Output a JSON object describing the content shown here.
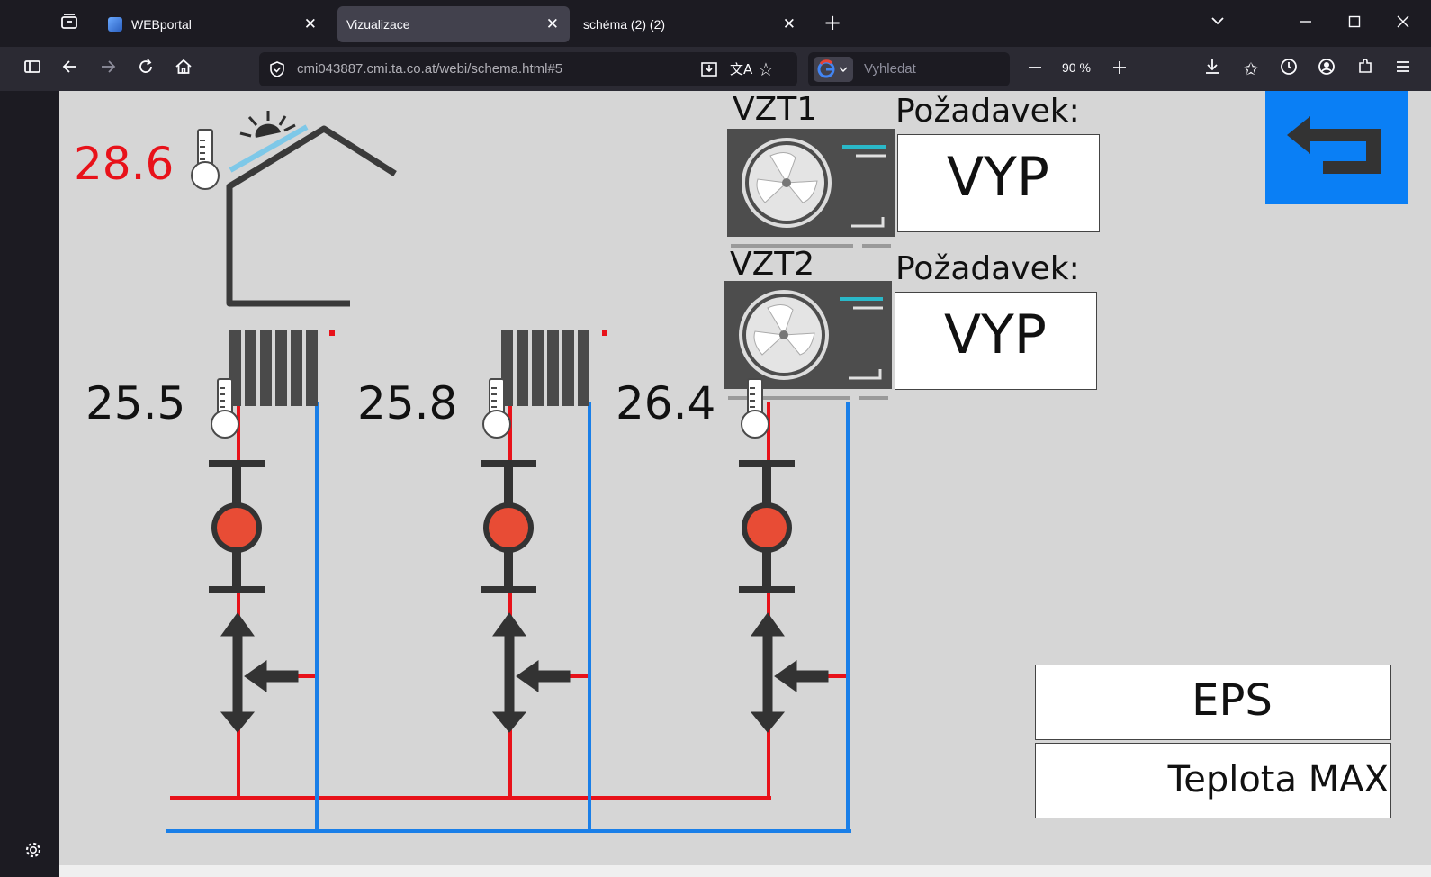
{
  "browser": {
    "tabs": [
      {
        "label": "WEBportal",
        "active": false
      },
      {
        "label": "Vizualizace",
        "active": true
      },
      {
        "label": "schéma (2) (2)",
        "active": false
      }
    ],
    "url": "cmi043887.cmi.ta.co.at/webi/schema.html#5",
    "search_placeholder": "Vyhledat",
    "zoom": "90 %"
  },
  "schema": {
    "outdoor_temp": "28.6",
    "outdoor_temp_color": "#e8121a",
    "circuits": [
      {
        "temp": "25.5"
      },
      {
        "temp": "25.8"
      },
      {
        "temp": "26.4"
      }
    ],
    "vzt": [
      {
        "name": "VZT1",
        "request_label": "Požadavek:",
        "status": "VYP"
      },
      {
        "name": "VZT2",
        "request_label": "Požadavek:",
        "status": "VYP"
      }
    ],
    "indicators": [
      {
        "label": "EPS",
        "color": "#4aa83c"
      },
      {
        "label": "Teplota MAX",
        "color": "#4aa83c"
      }
    ],
    "back_button_color": "#0a7ff5",
    "pipe_supply_color": "#e8121a",
    "pipe_return_color": "#1a7fe8"
  }
}
